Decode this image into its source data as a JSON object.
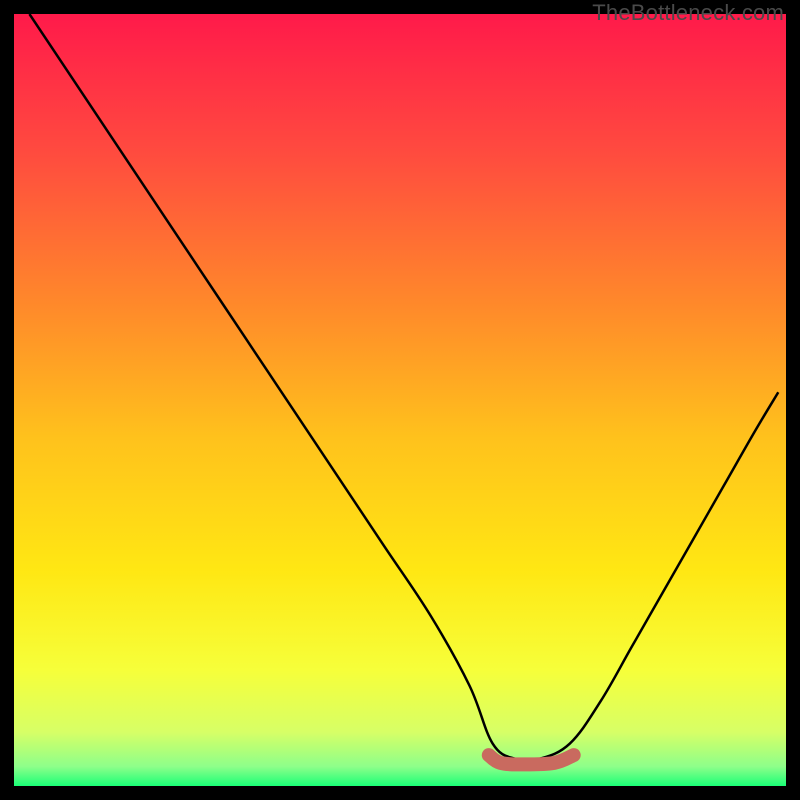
{
  "watermark": "TheBottleneck.com",
  "chart_data": {
    "type": "line",
    "title": "",
    "xlabel": "",
    "ylabel": "",
    "xlim": [
      0,
      100
    ],
    "ylim": [
      0,
      100
    ],
    "axes_visible": false,
    "background": {
      "type": "vertical_gradient",
      "description": "Vertical gradient running from red at top through orange, yellow, to narrow green band at bottom, resembling a bottleneck severity scale.",
      "stops": [
        {
          "offset": 0.0,
          "color": "#ff1a4a"
        },
        {
          "offset": 0.18,
          "color": "#ff4b3f"
        },
        {
          "offset": 0.38,
          "color": "#ff8a2a"
        },
        {
          "offset": 0.55,
          "color": "#ffc21c"
        },
        {
          "offset": 0.72,
          "color": "#ffe713"
        },
        {
          "offset": 0.85,
          "color": "#f6ff3a"
        },
        {
          "offset": 0.93,
          "color": "#d7ff66"
        },
        {
          "offset": 0.975,
          "color": "#8dff8a"
        },
        {
          "offset": 1.0,
          "color": "#1aff77"
        }
      ]
    },
    "series": [
      {
        "name": "bottleneck-curve",
        "description": "V-shaped curve. Falls from top-left corner down to a flat minimum near x≈62–72, then rises to roughly half height at the right edge.",
        "color": "#000000",
        "stroke_width": 2.5,
        "x": [
          2,
          6,
          12,
          18,
          24,
          30,
          36,
          42,
          48,
          54,
          59,
          62,
          65,
          68,
          72,
          76,
          80,
          84,
          88,
          92,
          96,
          99
        ],
        "values": [
          100,
          94,
          85,
          76,
          67,
          58,
          49,
          40,
          31,
          22,
          13,
          5.5,
          3.5,
          3.5,
          5.5,
          11,
          18,
          25,
          32,
          39,
          46,
          51
        ]
      },
      {
        "name": "optimal-range-marker",
        "description": "Short thick rounded segment at the curve minimum indicating the sweet spot.",
        "color": "#c96a5f",
        "stroke_width": 14,
        "linecap": "round",
        "x": [
          61.5,
          63,
          66,
          70,
          72.5
        ],
        "values": [
          4.0,
          3.0,
          2.8,
          3.0,
          4.0
        ]
      }
    ]
  }
}
